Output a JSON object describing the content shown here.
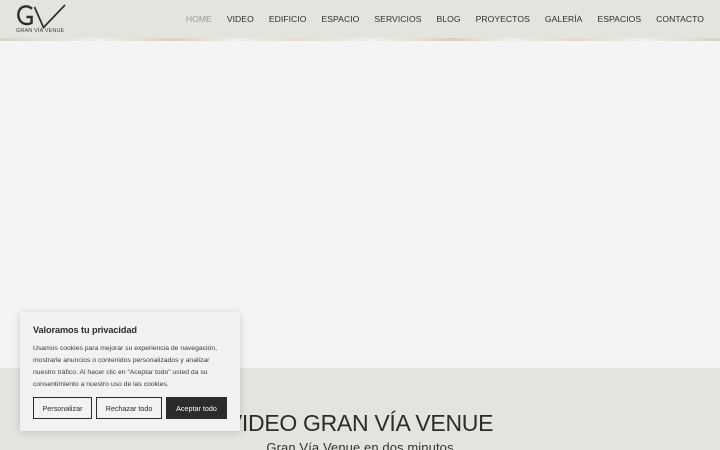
{
  "logo": {
    "text": "GRAN VÍA VENUE",
    "monogram": "GV"
  },
  "nav": {
    "items": [
      {
        "label": "HOME",
        "active": true
      },
      {
        "label": "VIDEO",
        "active": false
      },
      {
        "label": "EDIFICIO",
        "active": false
      },
      {
        "label": "ESPACIO",
        "active": false
      },
      {
        "label": "SERVICIOS",
        "active": false
      },
      {
        "label": "BLOG",
        "active": false
      },
      {
        "label": "PROYECTOS",
        "active": false
      },
      {
        "label": "GALERÍA",
        "active": false
      },
      {
        "label": "ESPACIOS",
        "active": false
      },
      {
        "label": "CONTACTO",
        "active": false
      }
    ]
  },
  "video_section": {
    "title": "VIDEO GRAN VÍA VENUE",
    "subtitle": "Gran Vía Venue en dos minutos"
  },
  "cookie_banner": {
    "title": "Valoramos tu privacidad",
    "text": "Usamos cookies para mejorar su experiencia de navegación, mostrarle anuncios o contenidos personalizados y analizar nuestro tráfico. Al hacer clic en “Aceptar todo” usted da su consentimiento a nuestro uso de las cookies.",
    "customize_label": "Personalizar",
    "reject_label": "Rechazar todo",
    "accept_label": "Aceptar todo"
  },
  "colors": {
    "header_bg": "#e4e3de",
    "hero_bg": "#f4f4f4",
    "accent_dark": "#2b2b2b",
    "nav_active": "#9a9a9a"
  }
}
